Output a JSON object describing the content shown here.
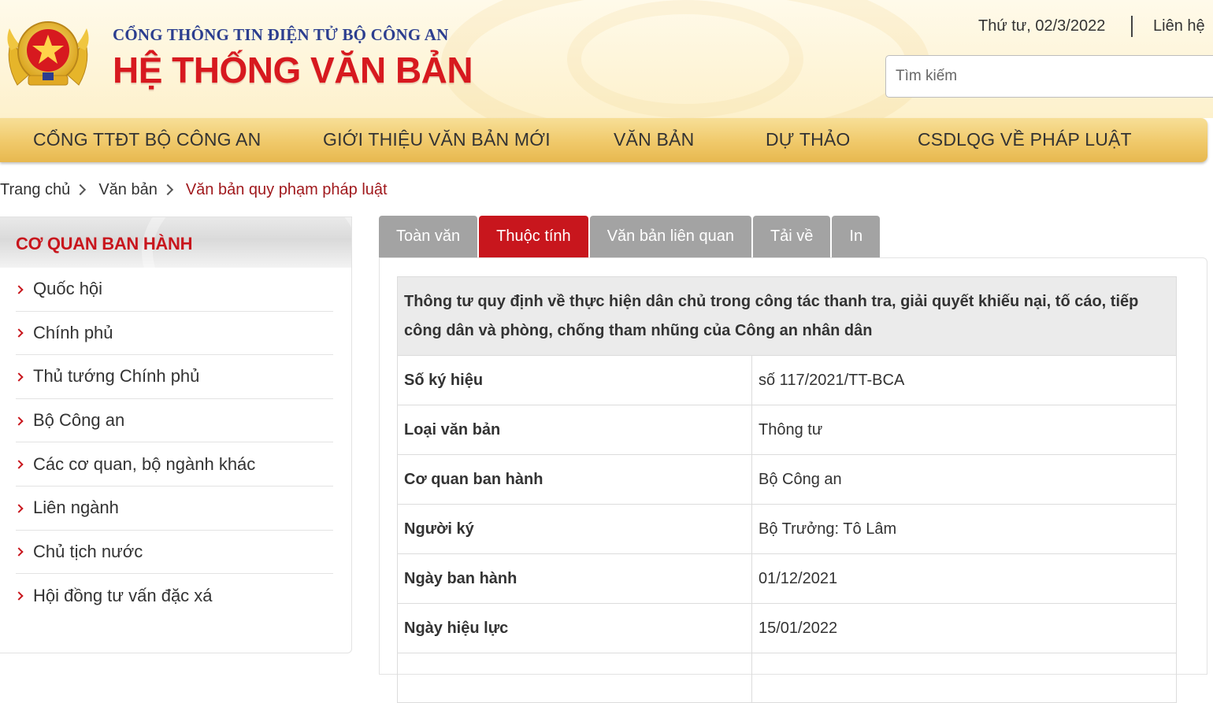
{
  "header": {
    "portal_name": "CỔNG THÔNG TIN ĐIỆN TỬ BỘ CÔNG AN",
    "site_title": "HỆ THỐNG VĂN BẢN",
    "date": "Thứ tư, 02/3/2022",
    "contact": "Liên hệ",
    "search_placeholder": "Tìm kiếm"
  },
  "nav": {
    "items": [
      {
        "label": "CỔNG TTĐT BỘ CÔNG AN"
      },
      {
        "label": "GIỚI THIỆU VĂN BẢN MỚI"
      },
      {
        "label": "VĂN BẢN"
      },
      {
        "label": "DỰ THẢO"
      },
      {
        "label": "CSDLQG VỀ PHÁP LUẬT"
      }
    ]
  },
  "breadcrumb": [
    {
      "label": "Trang chủ"
    },
    {
      "label": "Văn bản"
    },
    {
      "label": "Văn bản quy phạm pháp luật"
    }
  ],
  "sidebar": {
    "title": "CƠ QUAN BAN HÀNH",
    "items": [
      {
        "label": "Quốc hội"
      },
      {
        "label": "Chính phủ"
      },
      {
        "label": "Thủ tướng Chính phủ"
      },
      {
        "label": "Bộ Công an"
      },
      {
        "label": "Các cơ quan, bộ ngành khác"
      },
      {
        "label": "Liên ngành"
      },
      {
        "label": "Chủ tịch nước"
      },
      {
        "label": "Hội đồng tư vấn đặc xá"
      }
    ]
  },
  "tabs": [
    {
      "label": "Toàn văn",
      "active": false
    },
    {
      "label": "Thuộc tính",
      "active": true
    },
    {
      "label": "Văn bản liên quan",
      "active": false
    },
    {
      "label": "Tải về",
      "active": false
    },
    {
      "label": "In",
      "active": false
    }
  ],
  "document": {
    "title": "Thông tư quy định về thực hiện dân chủ trong công tác thanh tra, giải quyết khiếu nại, tố cáo, tiếp công dân và phòng, chống tham nhũng của Công an nhân dân",
    "properties": [
      {
        "label": "Số ký hiệu",
        "value": "số 117/2021/TT-BCA"
      },
      {
        "label": "Loại văn bản",
        "value": "Thông tư"
      },
      {
        "label": "Cơ quan ban hành",
        "value": "Bộ Công an"
      },
      {
        "label": "Người ký",
        "value": "Bộ Trưởng: Tô Lâm"
      },
      {
        "label": "Ngày ban hành",
        "value": "01/12/2021"
      },
      {
        "label": "Ngày hiệu lực",
        "value": "15/01/2022"
      }
    ]
  },
  "colors": {
    "brand_red": "#c8161d",
    "title_red": "#d7191f",
    "portal_blue": "#2c3e8f",
    "nav_gold": "#f0c96a",
    "tab_gray": "#a3a3a3"
  }
}
